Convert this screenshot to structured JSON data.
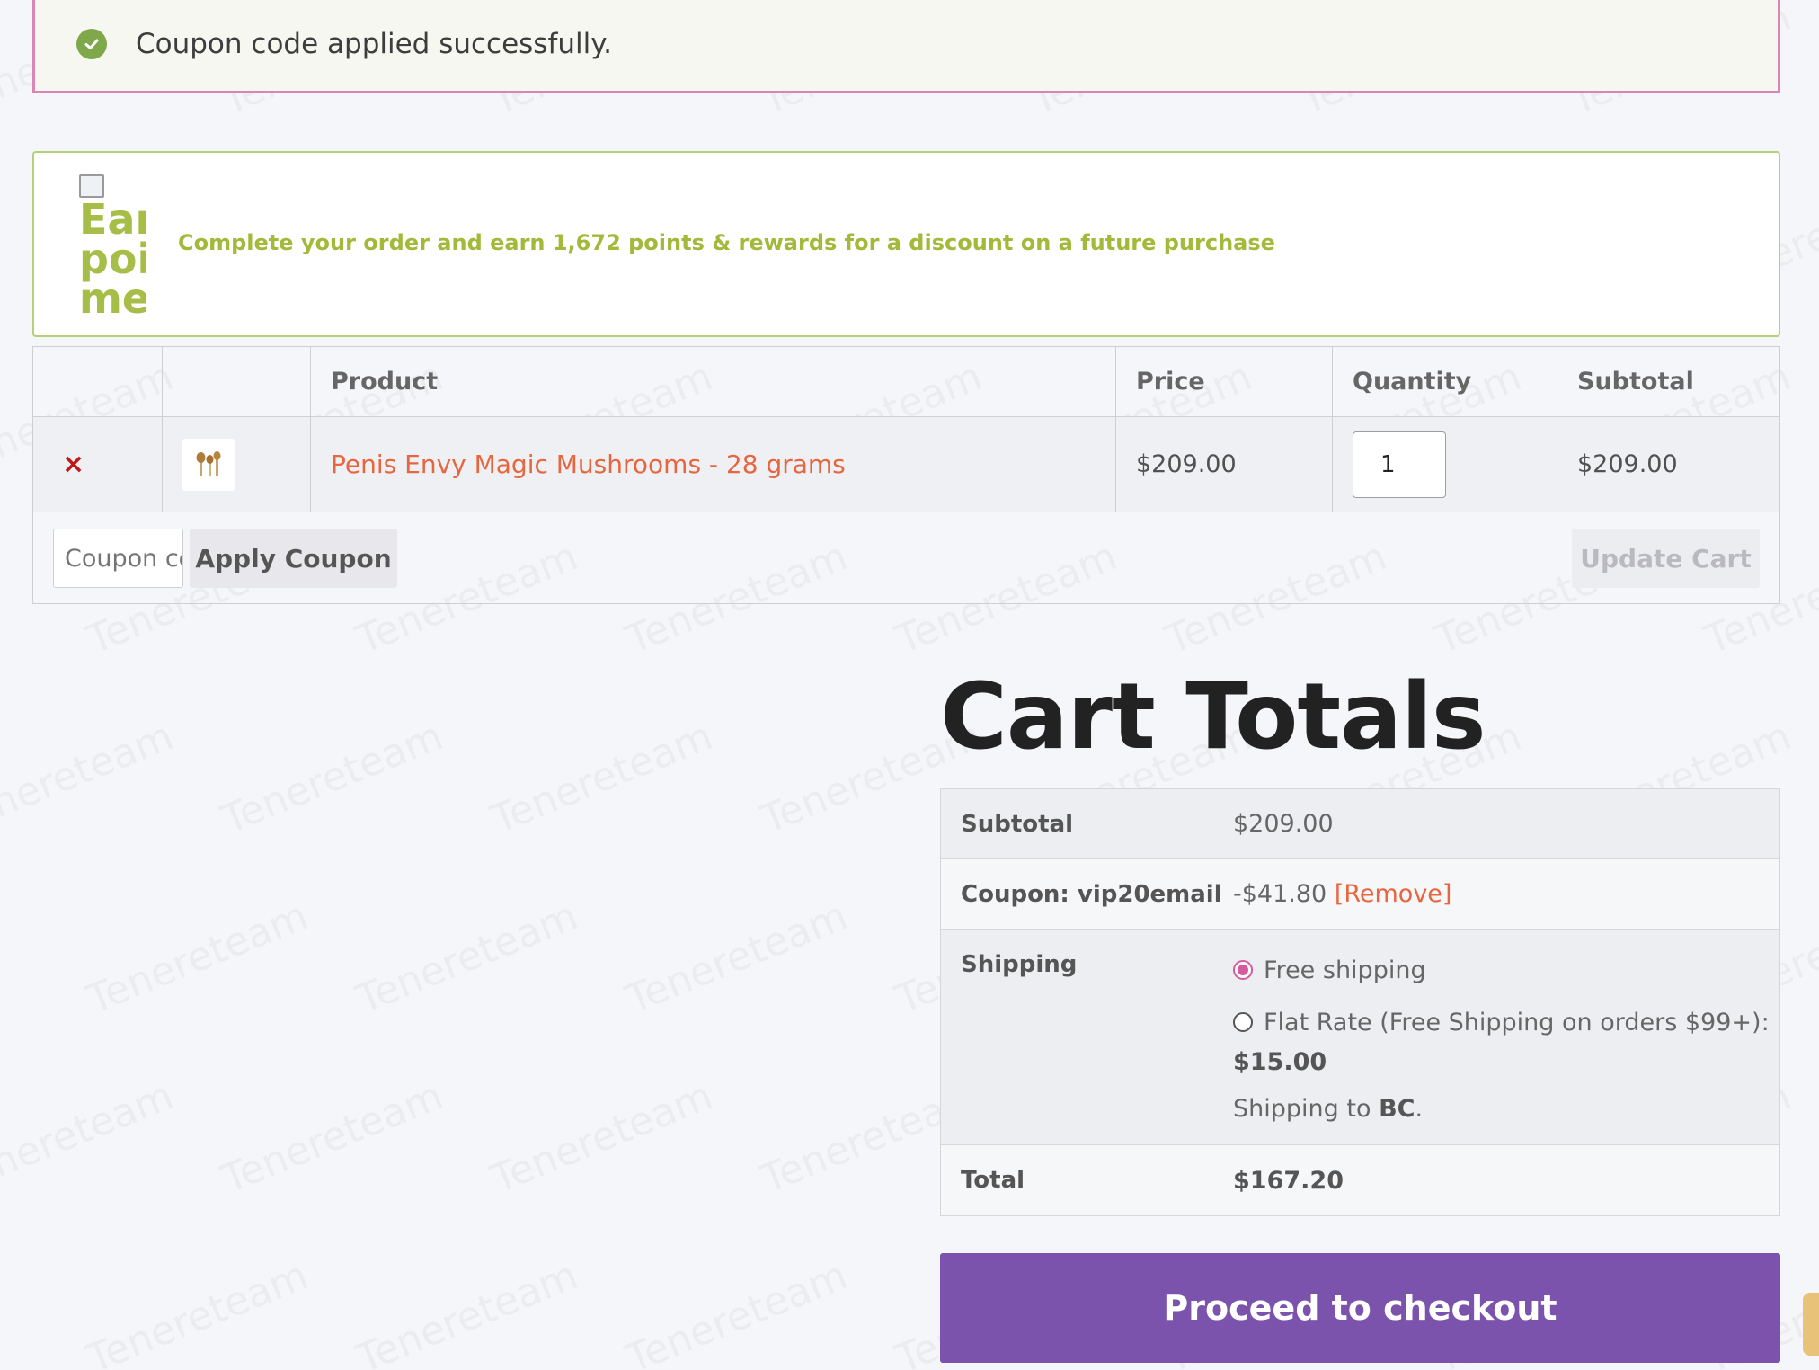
{
  "notice": {
    "message": "Coupon code applied successfully.",
    "icon": "check-circle-icon",
    "border_color": "#d986b4"
  },
  "points_banner": {
    "image_alt": "Earn points message",
    "message": "Complete your order and earn 1,672 points & rewards for a discount on a future purchase",
    "accent": "#a3b93a"
  },
  "cart_table": {
    "headers": [
      "",
      "",
      "Product",
      "Price",
      "Quantity",
      "Subtotal"
    ],
    "rows": [
      {
        "remove": "×",
        "product": "Penis Envy Magic Mushrooms - 28 grams",
        "price": "$209.00",
        "quantity": "1",
        "subtotal": "$209.00"
      }
    ],
    "coupon_placeholder": "Coupon code",
    "apply_label": "Apply Coupon",
    "update_label": "Update Cart"
  },
  "totals": {
    "title": "Cart Totals",
    "subtotal_label": "Subtotal",
    "subtotal_value": "$209.00",
    "coupon_label": "Coupon: vip20email",
    "coupon_value": "-$41.80",
    "coupon_remove": "[Remove]",
    "shipping_label": "Shipping",
    "shipping_options": [
      {
        "label": "Free shipping",
        "selected": true
      },
      {
        "label": "Flat Rate (Free Shipping on orders $99+):",
        "price": "$15.00",
        "selected": false
      }
    ],
    "shipping_to_prefix": "Shipping to",
    "shipping_to_region": "BC",
    "total_label": "Total",
    "total_value": "$167.20"
  },
  "checkout": {
    "label": "Proceed to checkout",
    "color": "#7b53ad"
  },
  "watermark": "Tenereteam"
}
